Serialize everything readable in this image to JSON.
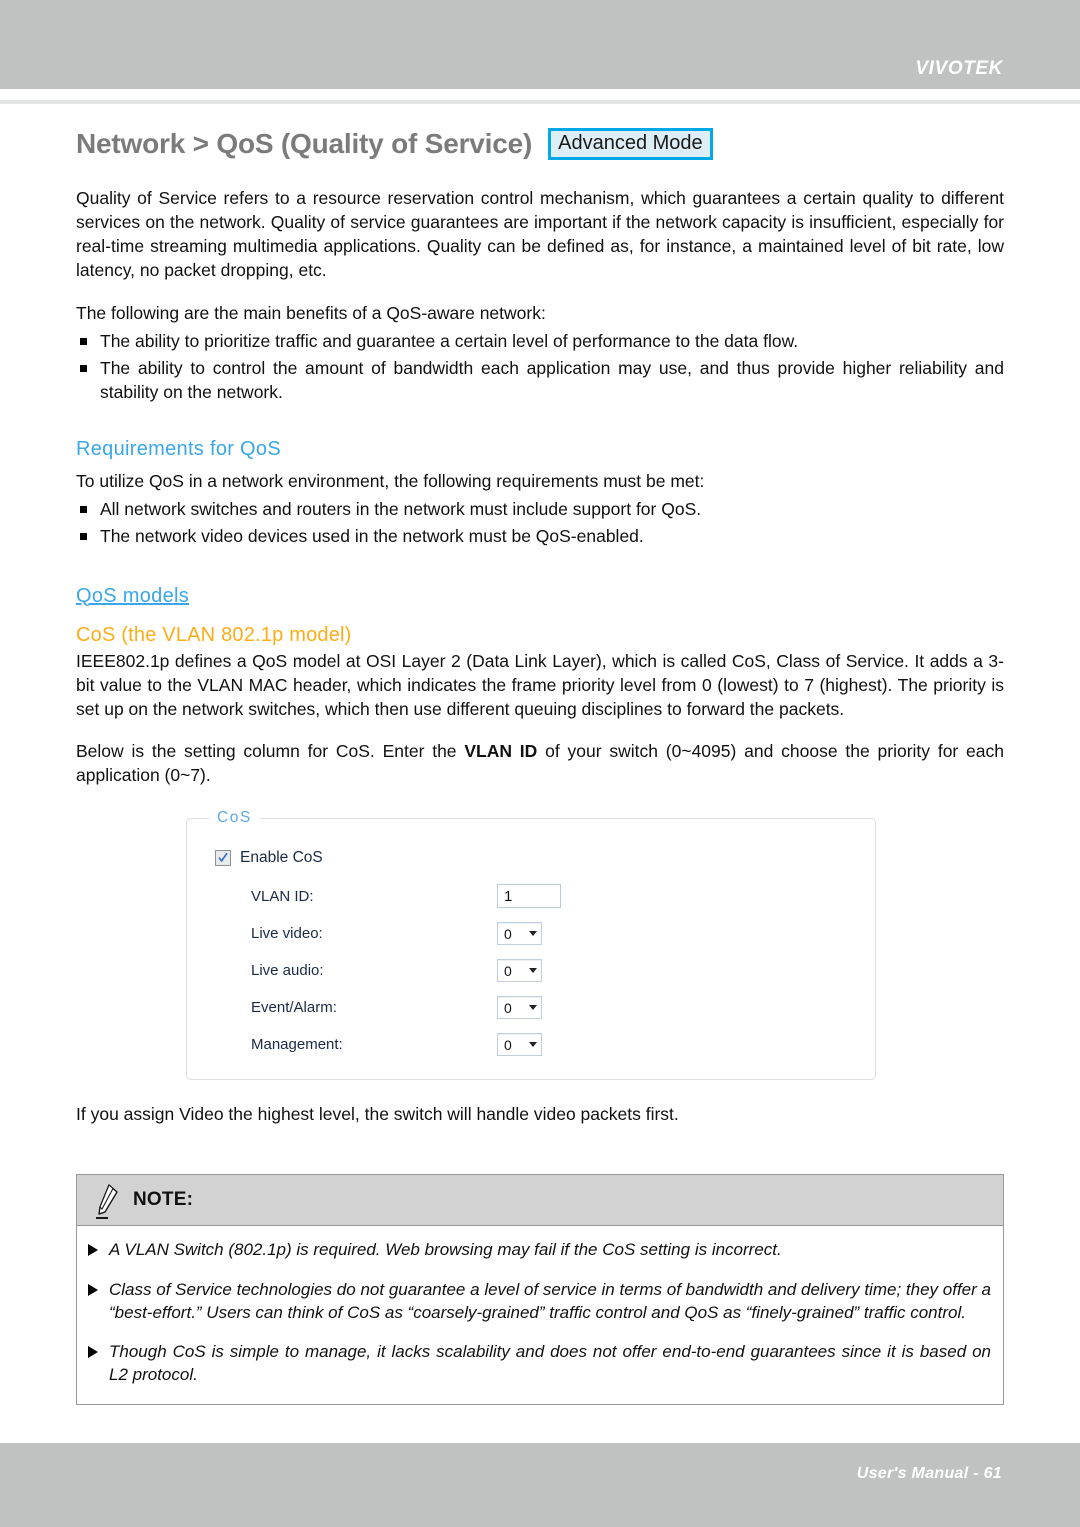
{
  "header": {
    "brand": "VIVOTEK"
  },
  "title": {
    "text": "Network > QoS (Quality of Service)",
    "badge": "Advanced Mode",
    "badge_border_color": "#00a8e8",
    "badge_bg_color": "#ddeef7",
    "title_color": "#7b7b7b"
  },
  "intro": {
    "paragraph": "Quality of Service refers to a resource reservation control mechanism, which guarantees a certain quality to different services on the network. Quality of service guarantees are important if the network capacity is insufficient, especially for real-time streaming multimedia applications. Quality can be defined as, for instance, a maintained level of bit rate, low latency, no packet dropping, etc.",
    "benefits_lead": "The following are the main benefits of a QoS-aware network:",
    "benefits": [
      "The ability to prioritize traffic and guarantee a certain level of performance to the data flow.",
      "The ability to control the amount of bandwidth each application may use, and thus provide higher reliability and stability on the network."
    ]
  },
  "requirements": {
    "heading": "Requirements for QoS",
    "heading_color": "#3aa7e8",
    "lead": "To utilize QoS in a network environment, the following requirements must be met:",
    "items": [
      "All network switches and routers in the network must include support for QoS.",
      "The network video devices used in the network must be QoS-enabled."
    ]
  },
  "models": {
    "heading": "QoS models",
    "heading_color": "#3aa7e8",
    "subheading": "CoS (the VLAN 802.1p model)",
    "subheading_color": "#fbad18",
    "paragraph": "IEEE802.1p defines a QoS model at OSI Layer 2 (Data Link Layer), which is called CoS, Class of Service. It adds a 3-bit value to the VLAN MAC header, which indicates the frame priority level from 0 (lowest) to 7 (highest). The priority is set up on the network switches, which then use different queuing disciplines to forward the packets.",
    "setting_paragraph_part1": "Below is the setting column for CoS. Enter the ",
    "setting_paragraph_bold": "VLAN ID",
    "setting_paragraph_part2": " of your switch (0~4095) and choose the priority for each application (0~7).",
    "after_panel": "If you assign Video the highest level, the switch will handle video packets first."
  },
  "cos_panel": {
    "legend": "CoS",
    "legend_color": "#5aa9e6",
    "enable_label": "Enable CoS",
    "enable_checked": true,
    "fields": [
      {
        "label": "VLAN ID:",
        "type": "text",
        "value": "1"
      },
      {
        "label": "Live video:",
        "type": "select",
        "value": "0"
      },
      {
        "label": "Live audio:",
        "type": "select",
        "value": "0"
      },
      {
        "label": "Event/Alarm:",
        "type": "select",
        "value": "0"
      },
      {
        "label": "Management:",
        "type": "select",
        "value": "0"
      }
    ]
  },
  "note": {
    "title": "NOTE:",
    "icon": "pencil-icon",
    "items": [
      "A VLAN Switch (802.1p) is required. Web browsing may fail if the CoS setting is incorrect.",
      "Class of Service technologies do not guarantee a level of service in terms of bandwidth and delivery time; they offer a “best-effort.” Users can think of CoS as “coarsely-grained” traffic control and QoS as “finely-grained” traffic control.",
      "Though CoS is simple to manage, it lacks scalability and does not offer end-to-end guarantees since it is based on L2 protocol."
    ]
  },
  "footer": {
    "text": "User's Manual - 61"
  }
}
